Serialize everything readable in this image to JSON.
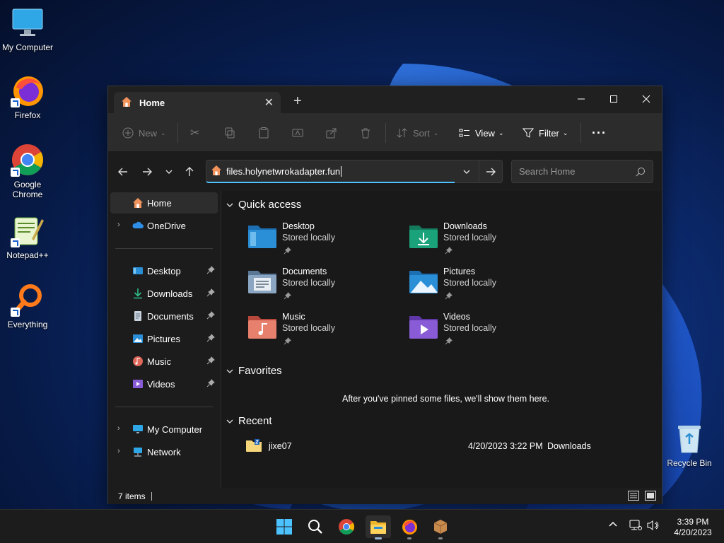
{
  "desktop": {
    "icons": [
      {
        "label": "My Computer",
        "icon": "monitor-icon"
      },
      {
        "label": "Firefox",
        "icon": "firefox-icon"
      },
      {
        "label": "Google Chrome",
        "icon": "chrome-icon"
      },
      {
        "label": "Notepad++",
        "icon": "notepadpp-icon"
      },
      {
        "label": "Everything",
        "icon": "everything-search-icon"
      },
      {
        "label": "Recycle Bin",
        "icon": "recycle-bin-icon"
      }
    ]
  },
  "window": {
    "tab_label": "Home",
    "toolbar": {
      "new_label": "New",
      "sort_label": "Sort",
      "view_label": "View",
      "filter_label": "Filter"
    },
    "address": {
      "value": "files.holynetwrokadapter.fun"
    },
    "search": {
      "placeholder": "Search Home"
    },
    "sidebar": {
      "items": [
        {
          "label": "Home",
          "icon": "home-icon"
        },
        {
          "label": "OneDrive",
          "icon": "onedrive-icon"
        },
        {
          "label": "Desktop",
          "icon": "desktop-folder-icon"
        },
        {
          "label": "Downloads",
          "icon": "download-icon"
        },
        {
          "label": "Documents",
          "icon": "documents-icon"
        },
        {
          "label": "Pictures",
          "icon": "pictures-icon"
        },
        {
          "label": "Music",
          "icon": "music-icon"
        },
        {
          "label": "Videos",
          "icon": "videos-icon"
        },
        {
          "label": "My Computer",
          "icon": "monitor-icon"
        },
        {
          "label": "Network",
          "icon": "network-icon"
        }
      ]
    },
    "sections": {
      "quick_access": "Quick access",
      "favorites": "Favorites",
      "recent": "Recent"
    },
    "quick_access": [
      {
        "name": "Desktop",
        "status": "Stored locally"
      },
      {
        "name": "Downloads",
        "status": "Stored locally"
      },
      {
        "name": "Documents",
        "status": "Stored locally"
      },
      {
        "name": "Pictures",
        "status": "Stored locally"
      },
      {
        "name": "Music",
        "status": "Stored locally"
      },
      {
        "name": "Videos",
        "status": "Stored locally"
      }
    ],
    "favorites_empty": "After you've pinned some files, we'll show them here.",
    "recent": [
      {
        "name": "jixe07",
        "date": "4/20/2023 3:22 PM",
        "location": "Downloads"
      }
    ],
    "status": {
      "items": "7 items"
    }
  },
  "taskbar": {
    "clock_time": "3:39 PM",
    "clock_date": "4/20/2023"
  },
  "colors": {
    "accent": "#4cc2ff",
    "folder_blue": "#2a8fd6",
    "folder_green": "#1aa37a",
    "folder_docs": "#7a9bbf",
    "folder_music": "#e0685a",
    "folder_videos": "#8a5bd6"
  }
}
